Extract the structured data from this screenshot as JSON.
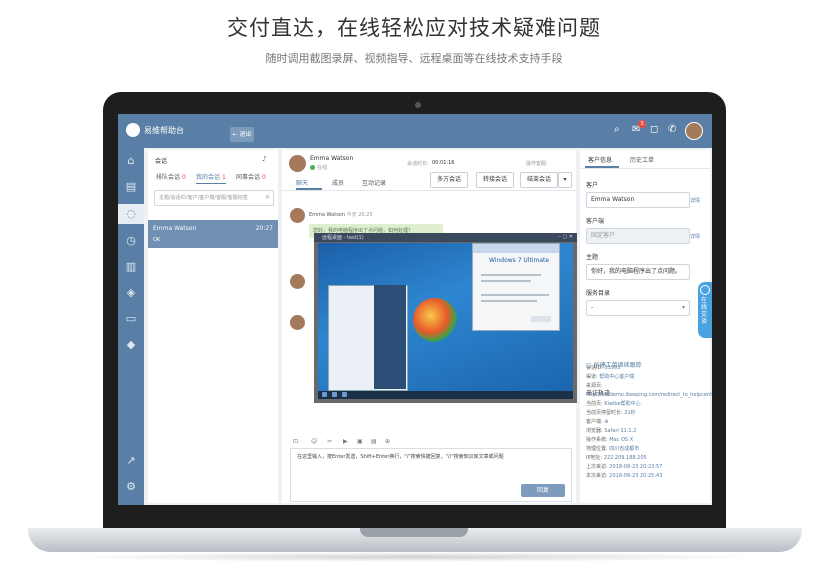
{
  "hero": {
    "title": "交付直达，在线轻松应对技术疑难问题",
    "subtitle": "随时调用截图录屏、视频指导、远程桌面等在线技术支持手段"
  },
  "app": {
    "title": "易维帮助台",
    "back_label": "← 退出"
  },
  "topbar": {
    "badge_count": "3"
  },
  "sessions_panel": {
    "title": "会话",
    "tabs": [
      {
        "label": "排队会话",
        "count": "0"
      },
      {
        "label": "我的会话",
        "count": "1"
      },
      {
        "label": "同事会话",
        "count": "0"
      }
    ],
    "search_placeholder": "主题/会话ID/客户/客户端/客服/客服标签",
    "session": {
      "name": "Emma Watson",
      "time": "20:27",
      "last_msg": "OK"
    }
  },
  "chat": {
    "customer_name": "Emma Watson",
    "customer_status": "在线",
    "duration_label": "会话时长:",
    "duration": "00:01:16",
    "agent_label": "操作客服:",
    "tabs": [
      "聊天",
      "成员",
      "互动记录"
    ],
    "buttons": [
      "多方会话",
      "转接会话",
      "结束会话"
    ],
    "messages": [
      {
        "name": "Emma Watson",
        "time": "今天 20:25",
        "text": "您好，我的电脑程序出了点问题，如何处理？"
      }
    ],
    "remote_desktop": {
      "title": "远程桌面 - test(1)",
      "about_title": "Windows 7 Ultimate"
    },
    "composer": {
      "text": "在这里输入，按Enter发送，Shift+Enter换行，\"/\"搜索快捷回复，\"//\"搜索知识库文章或问题",
      "send_label": "回复"
    }
  },
  "right_panel": {
    "tabs": [
      "客户信息",
      "历史工单"
    ],
    "customer_label": "客户",
    "customer_value": "Emma Watson",
    "detail_link": "详情",
    "client_label": "客户端",
    "client_value": "固定客户",
    "subject_label": "主题",
    "subject_value": "你好，我的电脑程序出了点问题。",
    "service_label": "服务目录",
    "service_value": "-",
    "new_ticket": "创建工单继续跟踪",
    "visit_title": "来访轨迹",
    "visit_info": [
      {
        "label": "会话ID:",
        "value": "51995"
      },
      {
        "label": "渠道:",
        "value": "帮助中心客户端"
      },
      {
        "label": "来源页:",
        "value": "http://kiwdemo.ibeeping.com/redirect_to_helpcenter"
      },
      {
        "label": "当前页:",
        "value": "Kiwibe帮助中心"
      },
      {
        "label": "当前页停留时长:",
        "value": "21秒"
      },
      {
        "label": "客户端:",
        "value": "⊕"
      },
      {
        "label": "浏览器:",
        "value": "Safari 11.1.2"
      },
      {
        "label": "操作系统:",
        "value": "Mac OS X"
      },
      {
        "label": "地理位置:",
        "value": "四川省成都市"
      },
      {
        "label": "IP地址:",
        "value": "222.209.188.205"
      },
      {
        "label": "上次来访:",
        "value": "2018-08-23 20:23:57"
      },
      {
        "label": "本次来访:",
        "value": "2018-08-23 20:25:43"
      }
    ],
    "online_chat": "在线交谈"
  }
}
